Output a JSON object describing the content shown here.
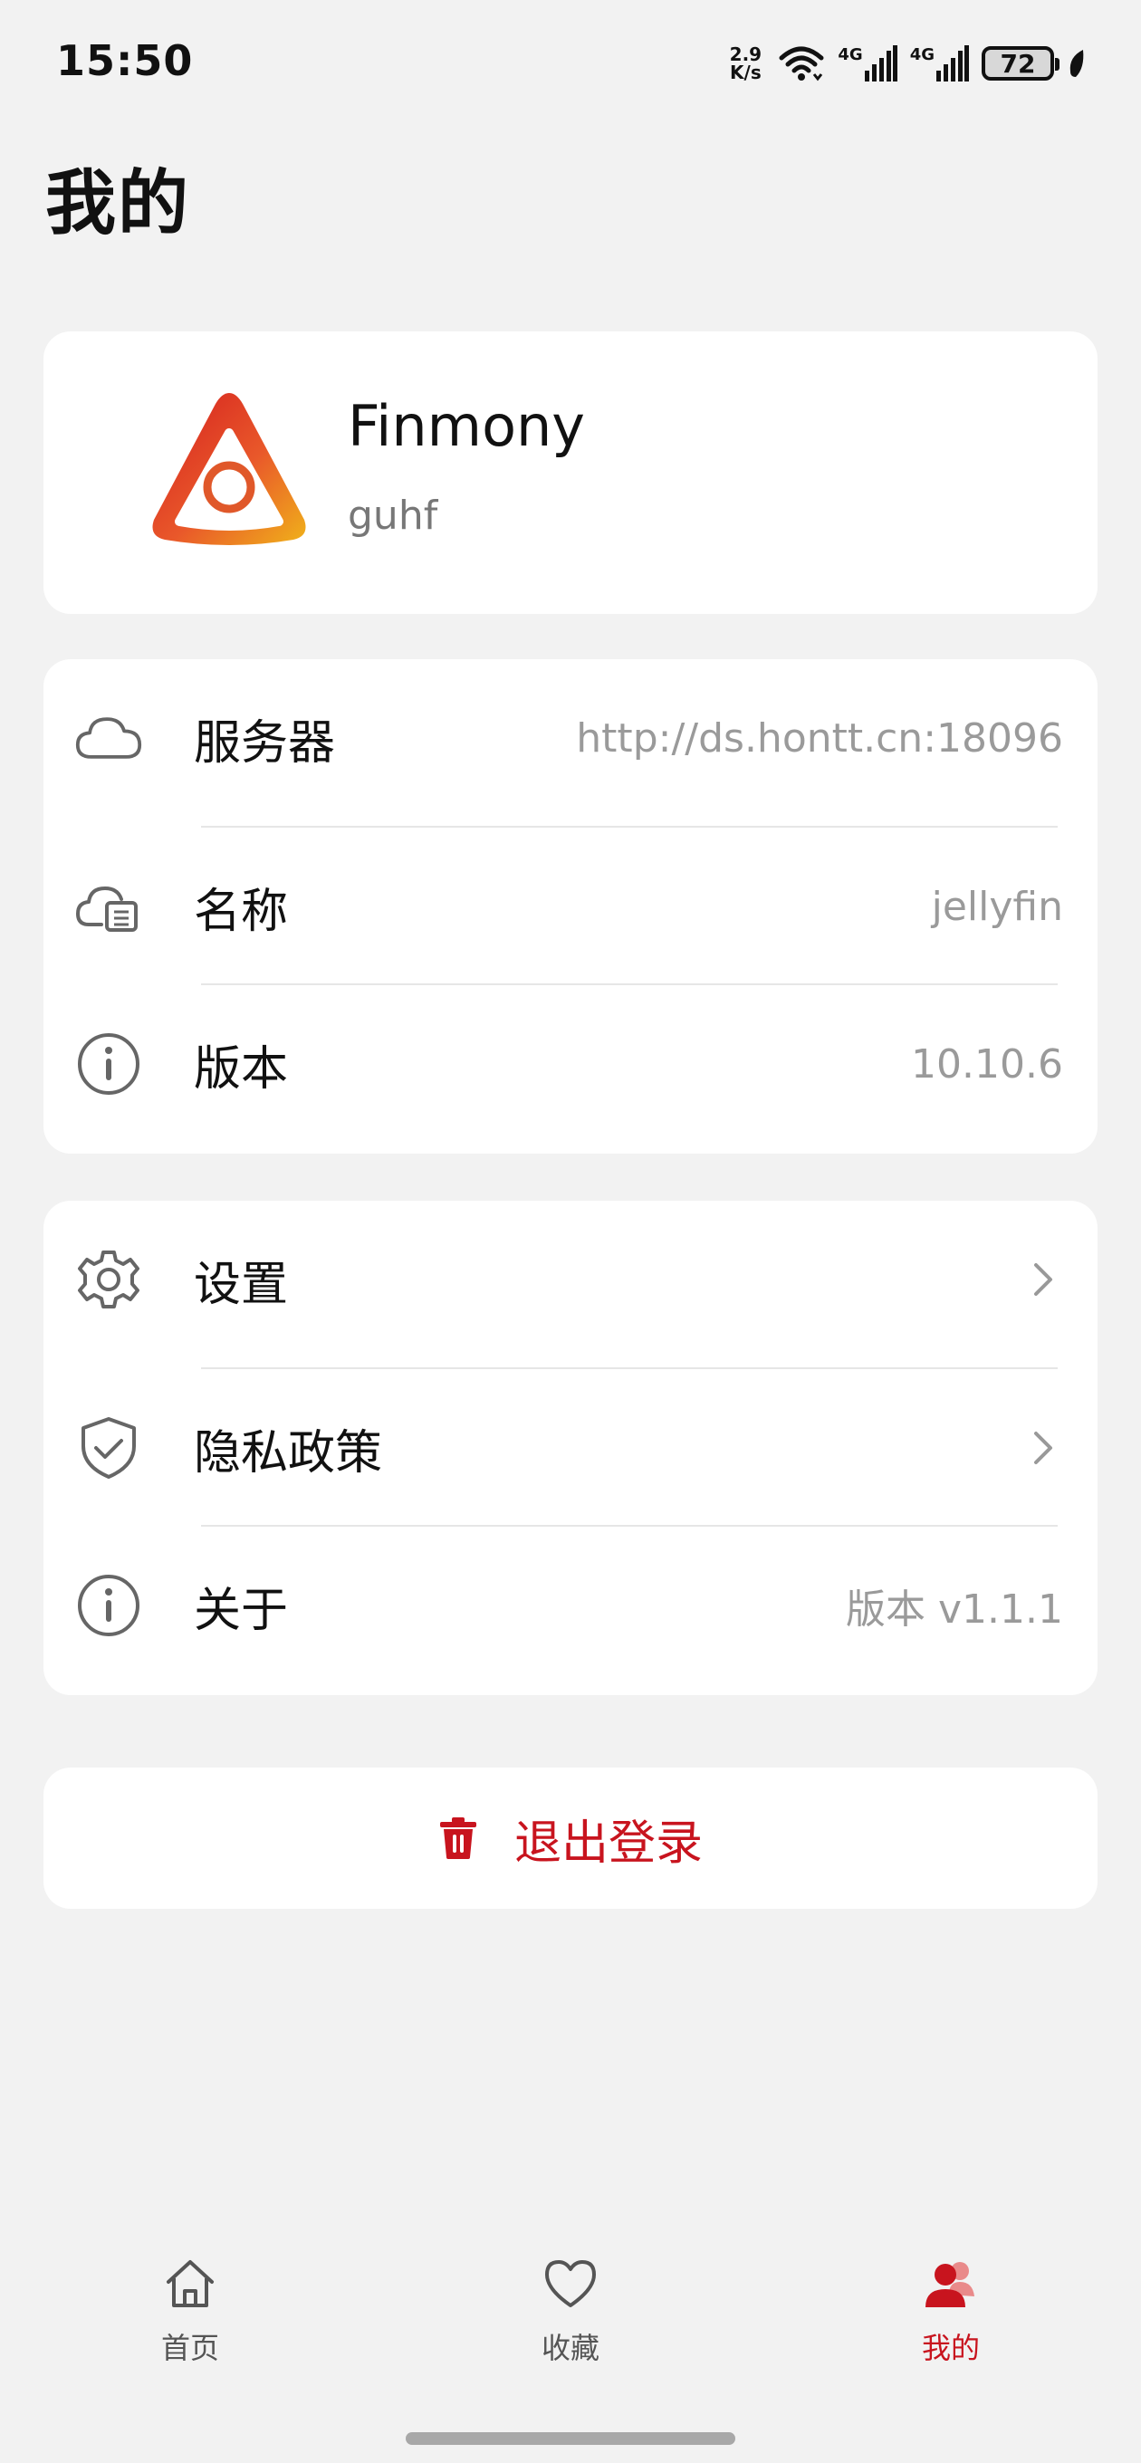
{
  "status_bar": {
    "time": "15:50",
    "net_speed_value": "2.9",
    "net_speed_unit": "K/s",
    "signal1_label": "4G",
    "signal2_label": "4G",
    "battery": "72"
  },
  "header": {
    "title": "我的"
  },
  "profile": {
    "app_name": "Finmony",
    "username": "guhf"
  },
  "server_info": {
    "rows": [
      {
        "label": "服务器",
        "value": "http://ds.hontt.cn:18096",
        "icon": "cloud-icon"
      },
      {
        "label": "名称",
        "value": "jellyfin",
        "icon": "cloud-document-icon"
      },
      {
        "label": "版本",
        "value": "10.10.6",
        "icon": "info-icon"
      }
    ]
  },
  "settings": {
    "rows": [
      {
        "label": "设置",
        "icon": "gear-icon"
      },
      {
        "label": "隐私政策",
        "icon": "shield-check-icon"
      },
      {
        "label": "关于",
        "value": "版本 v1.1.1",
        "icon": "info-icon"
      }
    ]
  },
  "logout": {
    "label": "退出登录",
    "icon": "trash-icon"
  },
  "bottom_nav": {
    "items": [
      {
        "label": "首页",
        "icon": "home-icon"
      },
      {
        "label": "收藏",
        "icon": "heart-icon"
      },
      {
        "label": "我的",
        "icon": "user-icon",
        "active": true
      }
    ]
  },
  "colors": {
    "accent": "#c8141e",
    "background": "#f2f2f2",
    "card": "#ffffff"
  }
}
